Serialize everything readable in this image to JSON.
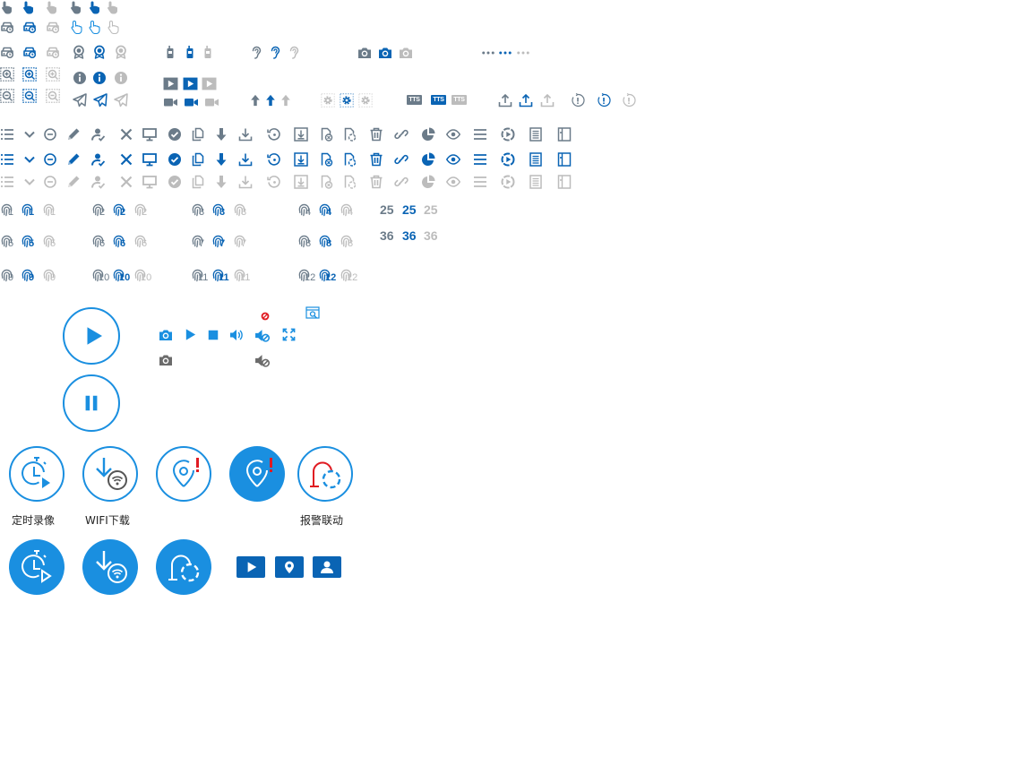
{
  "colors": {
    "dark": "#6b7b89",
    "accent": "#0a64b4",
    "light": "#bcbcbc",
    "bright": "#1a8fe0",
    "alert": "#e01b22"
  },
  "badge": {
    "tts_label": "TTS"
  },
  "counters": {
    "n25": "25",
    "n36": "36"
  },
  "channel_numbers": [
    "1",
    "2",
    "3",
    "4",
    "5",
    "6",
    "7",
    "8",
    "9",
    "10",
    "11",
    "12"
  ],
  "big_buttons": {
    "timed_record_label": "定时录像",
    "wifi_download_label": "WIFI下载",
    "alarm_link_label": "报警联动"
  }
}
